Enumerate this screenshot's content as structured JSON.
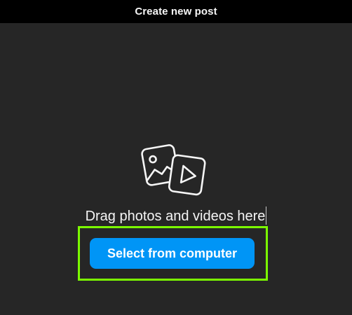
{
  "header": {
    "title": "Create new post"
  },
  "main": {
    "icon": "photo-video-icon",
    "drag_text": "Drag photos and videos here",
    "select_button_label": "Select from computer"
  },
  "colors": {
    "header_bg": "#000000",
    "body_bg": "#262626",
    "button_bg": "#0095f6",
    "highlight": "#7cfc00",
    "text": "#f5f5f5"
  }
}
